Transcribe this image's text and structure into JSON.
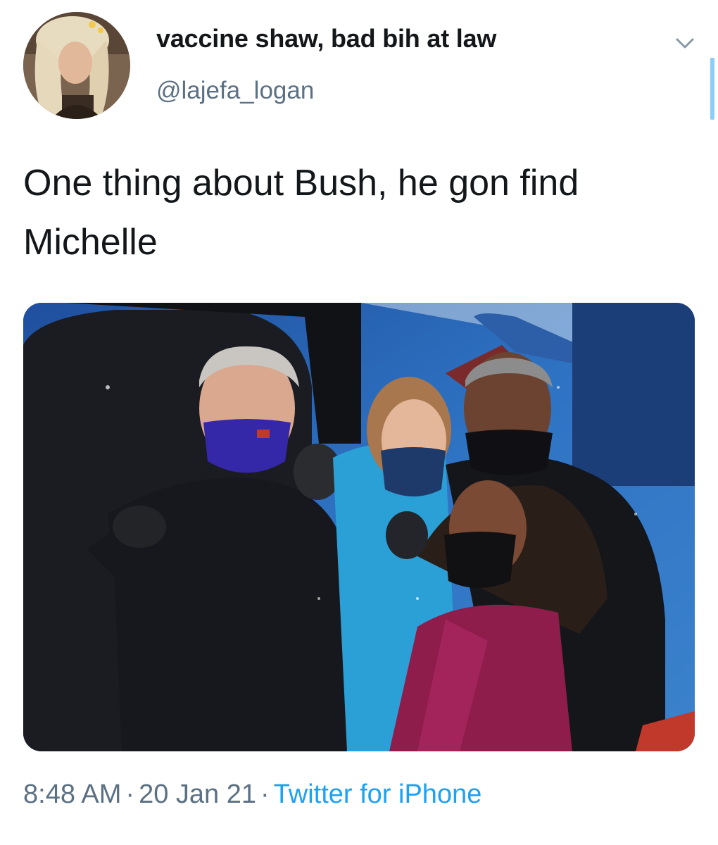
{
  "tweet": {
    "display_name": "vaccine shaw, bad bih at law",
    "handle": "@lajefa_logan",
    "text": "One thing about Bush, he gon find Michelle",
    "time": "8:48 AM",
    "date": "20 Jan 21",
    "source": "Twitter for iPhone",
    "separator": "·"
  },
  "icons": {
    "menu": "chevron-down-icon"
  },
  "colors": {
    "text_primary": "#14171a",
    "text_secondary": "#5b7083",
    "link": "#1da1f2",
    "scroll_indicator": "#8ecdf7"
  }
}
